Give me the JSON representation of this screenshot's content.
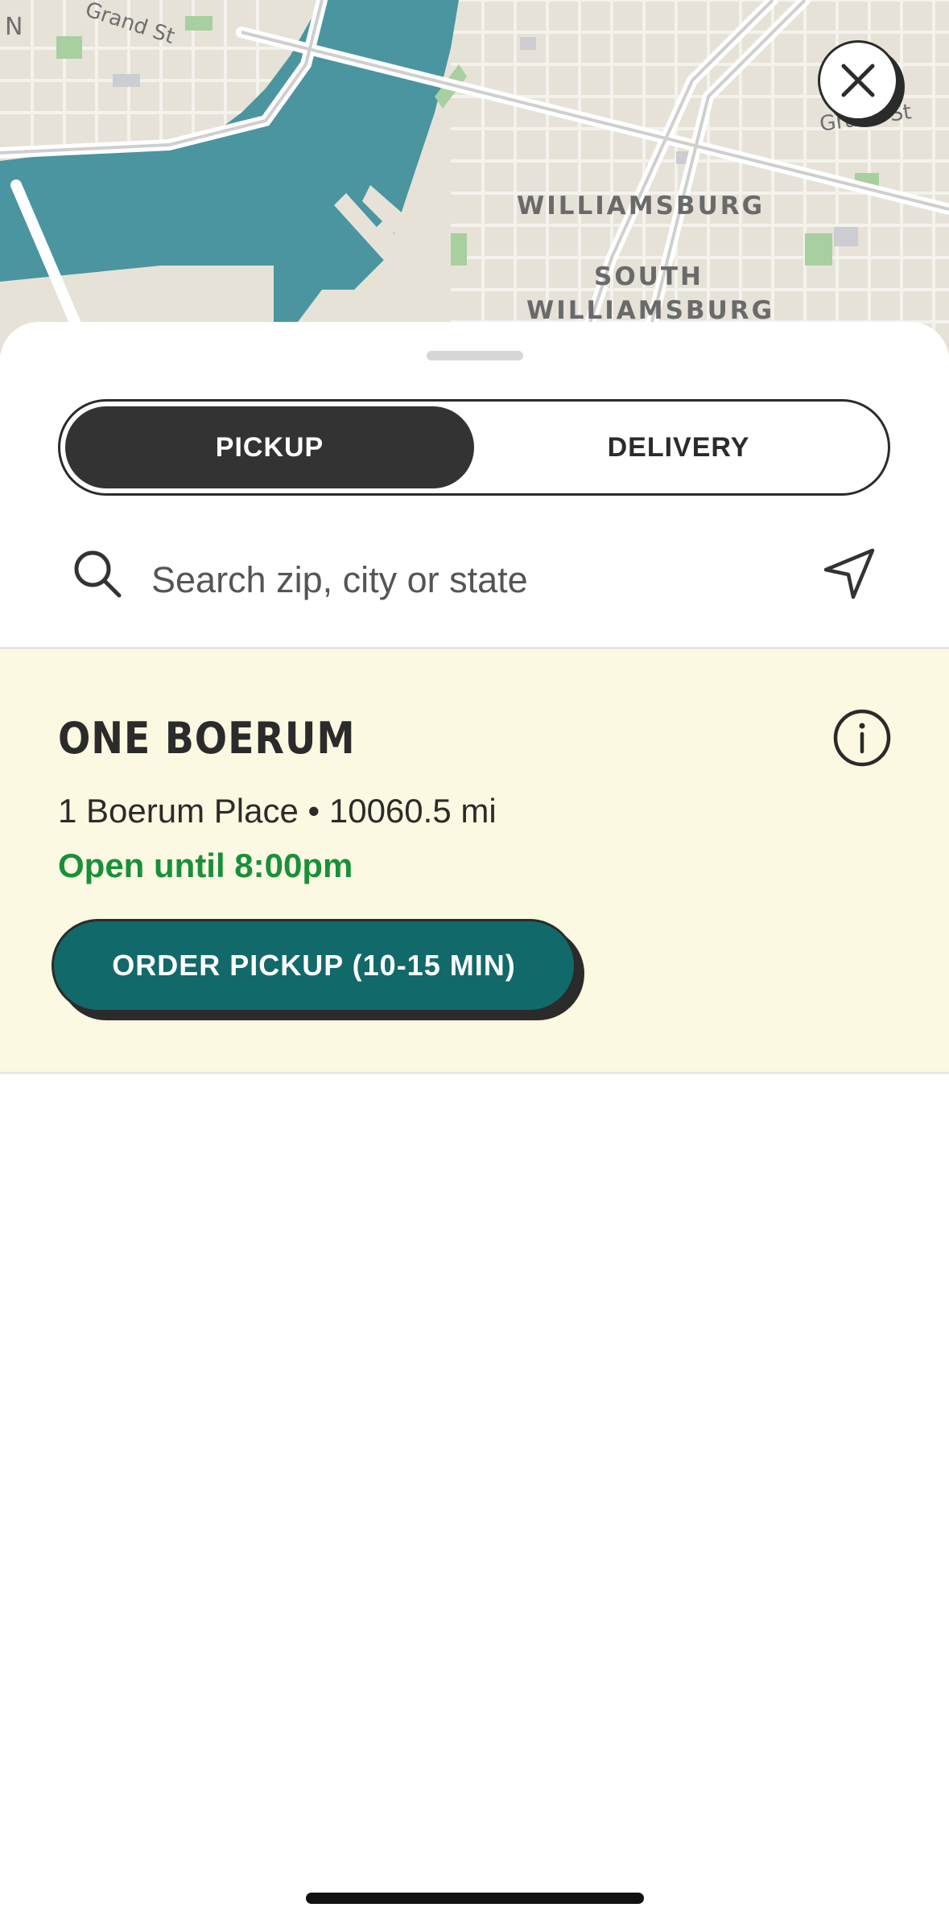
{
  "map": {
    "labels": {
      "williamsburg": "WILLIAMSBURG",
      "south_williamsburg_1": "SOUTH",
      "south_williamsburg_2": "WILLIAMSBURG",
      "grand_st_left": "Grand St",
      "grand_st_right": "Grand St",
      "edge_letter": "N"
    },
    "colors": {
      "land": "#e6e2d8",
      "water": "#4a95a0",
      "park": "#a8cf9f",
      "road": "#ffffff"
    }
  },
  "close_button": {
    "icon": "close-icon"
  },
  "mode_toggle": {
    "pickup_label": "PICKUP",
    "delivery_label": "DELIVERY",
    "selected": "PICKUP"
  },
  "search": {
    "placeholder": "Search zip, city or state",
    "value": ""
  },
  "store": {
    "name": "ONE BOERUM",
    "address_line": "1 Boerum Place • 10060.5 mi",
    "hours": "Open until 8:00pm",
    "order_button_label": "ORDER PICKUP (10-15 MIN)",
    "card_color": "#fbf9e2",
    "hours_color": "#1a8f3a",
    "button_color": "#12696a"
  }
}
